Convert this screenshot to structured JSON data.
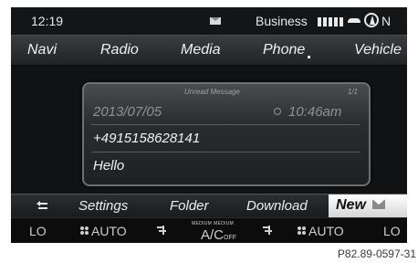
{
  "status_bar": {
    "time": "12:19",
    "profile": "Business",
    "heading": "N"
  },
  "main_menu": {
    "items": [
      "Navi",
      "Radio",
      "Media",
      "Phone",
      "Vehicle"
    ]
  },
  "message": {
    "title": "Unread Message",
    "index": "1/1",
    "date": "2013/07/05",
    "time": "10:46am",
    "sender": "+4915158628141",
    "body": "Hello"
  },
  "sub_menu": {
    "items": [
      "Settings",
      "Folder",
      "Download"
    ],
    "new_label": "New"
  },
  "climate": {
    "left_temp": "LO",
    "left_fan": "AUTO",
    "ac_label_left": "MEDIUM",
    "ac_label_right": "MEDIUM",
    "ac": "A/C",
    "ac_state": "OFF",
    "right_fan": "AUTO",
    "right_temp": "LO"
  },
  "figure_code": "P82.89-0597-31"
}
